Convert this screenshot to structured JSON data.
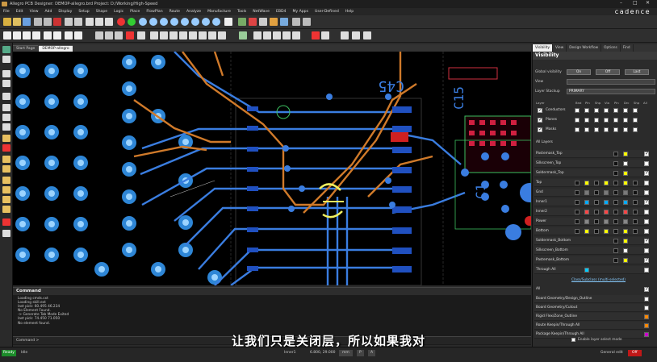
{
  "window": {
    "title": "Allegro PCB Designer: DEMOP-allegro.brd  Project: D:/Working/High-Speed",
    "min_glyph": "–",
    "max_glyph": "□",
    "close_glyph": "✕"
  },
  "brand": "cadence",
  "menu": [
    "File",
    "Edit",
    "View",
    "Add",
    "Display",
    "Setup",
    "Shape",
    "Logic",
    "Place",
    "FlowPlan",
    "Route",
    "Analyze",
    "Manufacture",
    "Tools",
    "NetWave",
    "EBD4",
    "My Apps",
    "User-Defined",
    "Help"
  ],
  "tabs": [
    {
      "label": "Start Page",
      "active": false
    },
    {
      "label": "DEMOP-allegro",
      "active": true
    }
  ],
  "canvas": {
    "text_labels": [
      "C45",
      "C1",
      "C15"
    ]
  },
  "command": {
    "title": "Command",
    "lines": [
      "Loading cmds.cxt",
      "Loading skill.ext",
      "last pick:  60.495 46.234",
      "No Element Found.",
      "-> Generate Tab Mode Exited",
      "last pick:  74.450 71.050",
      "No element found."
    ],
    "prompt": "Command >"
  },
  "subtitle": "让我们只是关闭层，所以如果我对",
  "status": {
    "ready": "Ready",
    "mode": "ldle",
    "layer": "Inner1",
    "coords": "6.800, 29.000",
    "unit": "mm",
    "field_p": "P",
    "field_a": "A",
    "edit_mode": "General edit",
    "off": "Off"
  },
  "right_panel": {
    "tabs": [
      {
        "label": "Visibility",
        "active": true
      },
      {
        "label": "View",
        "active": false
      },
      {
        "label": "Design Workflow",
        "active": false
      },
      {
        "label": "Options",
        "active": false
      },
      {
        "label": "Find",
        "active": false
      }
    ],
    "heading": "Visibility",
    "global_visibility_label": "Global visibility",
    "on_label": "On",
    "off_label": "Off",
    "last_label": "Last",
    "view_label": "View",
    "layer_stackup_label": "Layer Stackup",
    "layer_stackup_value": "PRIMARY",
    "layer_col_label": "Layer",
    "col_headers": [
      "Bnd",
      "Pln",
      "Shp",
      "Via",
      "Pin",
      "Drc",
      "Shp",
      "All"
    ],
    "class_rows": [
      "Conductors",
      "Planes",
      "Masks"
    ],
    "all_layers_label": "All Layers",
    "layers": [
      {
        "name": "Pastemask_Top",
        "kind": "mask",
        "color": "#ffff00",
        "checked": true
      },
      {
        "name": "Silkscreen_Top",
        "kind": "silk",
        "color": "#ffffff",
        "checked": false
      },
      {
        "name": "Soldermask_Top",
        "kind": "mask",
        "color": "#ffff00",
        "checked": true
      },
      {
        "name": "Top",
        "kind": "cond",
        "color": "#ffff00",
        "checked": false
      },
      {
        "name": "Gnd",
        "kind": "cond",
        "color": "#7a7a7a",
        "checked": false
      },
      {
        "name": "Inner1",
        "kind": "cond",
        "color": "#00aaff",
        "checked": true
      },
      {
        "name": "Inner2",
        "kind": "cond",
        "color": "#ff4444",
        "checked": false
      },
      {
        "name": "Power",
        "kind": "cond",
        "color": "#888888",
        "checked": false
      },
      {
        "name": "Bottom",
        "kind": "cond",
        "color": "#ffff00",
        "checked": false
      },
      {
        "name": "Soldermask_Bottom",
        "kind": "mask",
        "color": "#ffff00",
        "checked": true
      },
      {
        "name": "Silkscreen_Bottom",
        "kind": "silk",
        "color": "#ffffff",
        "checked": false
      },
      {
        "name": "Pastemask_Bottom",
        "kind": "mask",
        "color": "#ffff00",
        "checked": true
      },
      {
        "name": "Through All",
        "kind": "via",
        "color": "#00ccff",
        "checked": false
      }
    ],
    "class_subclass_link": "Class/Subclass (multi-selected)",
    "sub_all_label": "All",
    "subclasses": [
      {
        "name": "Board Geometry/Design_Outline",
        "color": "#ffffff"
      },
      {
        "name": "Board Geometry/Cutout",
        "color": "#ffffff"
      },
      {
        "name": "Rigid Flex/Zone_Outline",
        "color": "#ff8800"
      },
      {
        "name": "Route Keepin/Through All",
        "color": "#ff8800"
      },
      {
        "name": "Package Keepin/Through All",
        "color": "#cc00cc"
      }
    ],
    "enable_layer_select": "Enable layer select mode"
  }
}
